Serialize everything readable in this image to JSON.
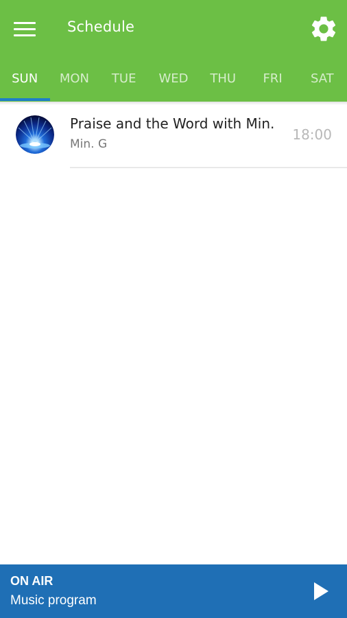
{
  "header": {
    "title": "Schedule",
    "menu_icon": "hamburger-menu-icon",
    "settings_icon": "gear-icon",
    "background_color": "#6cbf45"
  },
  "tabs": [
    {
      "label": "SUN",
      "active": true
    },
    {
      "label": "MON",
      "active": false
    },
    {
      "label": "TUE",
      "active": false
    },
    {
      "label": "WED",
      "active": false
    },
    {
      "label": "THU",
      "active": false
    },
    {
      "label": "FRI",
      "active": false
    },
    {
      "label": "SAT",
      "active": false
    }
  ],
  "schedule": {
    "items": [
      {
        "title": "Praise and the Word with Min.",
        "host": "Min. G",
        "time": "18:00",
        "thumbnail_icon": "light-burst-thumbnail"
      }
    ]
  },
  "player": {
    "status": "ON AIR",
    "program": "Music program",
    "play_icon": "play-icon",
    "background_color": "#1f6fb5"
  }
}
